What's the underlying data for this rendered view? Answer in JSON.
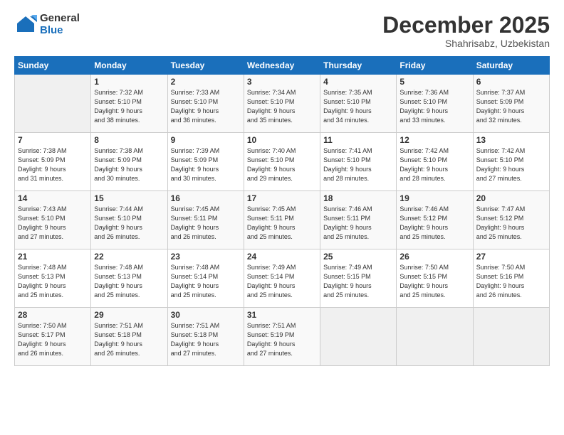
{
  "logo": {
    "general": "General",
    "blue": "Blue"
  },
  "title": {
    "month_year": "December 2025",
    "location": "Shahrisabz, Uzbekistan"
  },
  "header_days": [
    "Sunday",
    "Monday",
    "Tuesday",
    "Wednesday",
    "Thursday",
    "Friday",
    "Saturday"
  ],
  "weeks": [
    [
      {
        "day": "",
        "info": ""
      },
      {
        "day": "1",
        "info": "Sunrise: 7:32 AM\nSunset: 5:10 PM\nDaylight: 9 hours\nand 38 minutes."
      },
      {
        "day": "2",
        "info": "Sunrise: 7:33 AM\nSunset: 5:10 PM\nDaylight: 9 hours\nand 36 minutes."
      },
      {
        "day": "3",
        "info": "Sunrise: 7:34 AM\nSunset: 5:10 PM\nDaylight: 9 hours\nand 35 minutes."
      },
      {
        "day": "4",
        "info": "Sunrise: 7:35 AM\nSunset: 5:10 PM\nDaylight: 9 hours\nand 34 minutes."
      },
      {
        "day": "5",
        "info": "Sunrise: 7:36 AM\nSunset: 5:10 PM\nDaylight: 9 hours\nand 33 minutes."
      },
      {
        "day": "6",
        "info": "Sunrise: 7:37 AM\nSunset: 5:09 PM\nDaylight: 9 hours\nand 32 minutes."
      }
    ],
    [
      {
        "day": "7",
        "info": "Sunrise: 7:38 AM\nSunset: 5:09 PM\nDaylight: 9 hours\nand 31 minutes."
      },
      {
        "day": "8",
        "info": "Sunrise: 7:38 AM\nSunset: 5:09 PM\nDaylight: 9 hours\nand 30 minutes."
      },
      {
        "day": "9",
        "info": "Sunrise: 7:39 AM\nSunset: 5:09 PM\nDaylight: 9 hours\nand 30 minutes."
      },
      {
        "day": "10",
        "info": "Sunrise: 7:40 AM\nSunset: 5:10 PM\nDaylight: 9 hours\nand 29 minutes."
      },
      {
        "day": "11",
        "info": "Sunrise: 7:41 AM\nSunset: 5:10 PM\nDaylight: 9 hours\nand 28 minutes."
      },
      {
        "day": "12",
        "info": "Sunrise: 7:42 AM\nSunset: 5:10 PM\nDaylight: 9 hours\nand 28 minutes."
      },
      {
        "day": "13",
        "info": "Sunrise: 7:42 AM\nSunset: 5:10 PM\nDaylight: 9 hours\nand 27 minutes."
      }
    ],
    [
      {
        "day": "14",
        "info": "Sunrise: 7:43 AM\nSunset: 5:10 PM\nDaylight: 9 hours\nand 27 minutes."
      },
      {
        "day": "15",
        "info": "Sunrise: 7:44 AM\nSunset: 5:10 PM\nDaylight: 9 hours\nand 26 minutes."
      },
      {
        "day": "16",
        "info": "Sunrise: 7:45 AM\nSunset: 5:11 PM\nDaylight: 9 hours\nand 26 minutes."
      },
      {
        "day": "17",
        "info": "Sunrise: 7:45 AM\nSunset: 5:11 PM\nDaylight: 9 hours\nand 25 minutes."
      },
      {
        "day": "18",
        "info": "Sunrise: 7:46 AM\nSunset: 5:11 PM\nDaylight: 9 hours\nand 25 minutes."
      },
      {
        "day": "19",
        "info": "Sunrise: 7:46 AM\nSunset: 5:12 PM\nDaylight: 9 hours\nand 25 minutes."
      },
      {
        "day": "20",
        "info": "Sunrise: 7:47 AM\nSunset: 5:12 PM\nDaylight: 9 hours\nand 25 minutes."
      }
    ],
    [
      {
        "day": "21",
        "info": "Sunrise: 7:48 AM\nSunset: 5:13 PM\nDaylight: 9 hours\nand 25 minutes."
      },
      {
        "day": "22",
        "info": "Sunrise: 7:48 AM\nSunset: 5:13 PM\nDaylight: 9 hours\nand 25 minutes."
      },
      {
        "day": "23",
        "info": "Sunrise: 7:48 AM\nSunset: 5:14 PM\nDaylight: 9 hours\nand 25 minutes."
      },
      {
        "day": "24",
        "info": "Sunrise: 7:49 AM\nSunset: 5:14 PM\nDaylight: 9 hours\nand 25 minutes."
      },
      {
        "day": "25",
        "info": "Sunrise: 7:49 AM\nSunset: 5:15 PM\nDaylight: 9 hours\nand 25 minutes."
      },
      {
        "day": "26",
        "info": "Sunrise: 7:50 AM\nSunset: 5:15 PM\nDaylight: 9 hours\nand 25 minutes."
      },
      {
        "day": "27",
        "info": "Sunrise: 7:50 AM\nSunset: 5:16 PM\nDaylight: 9 hours\nand 26 minutes."
      }
    ],
    [
      {
        "day": "28",
        "info": "Sunrise: 7:50 AM\nSunset: 5:17 PM\nDaylight: 9 hours\nand 26 minutes."
      },
      {
        "day": "29",
        "info": "Sunrise: 7:51 AM\nSunset: 5:18 PM\nDaylight: 9 hours\nand 26 minutes."
      },
      {
        "day": "30",
        "info": "Sunrise: 7:51 AM\nSunset: 5:18 PM\nDaylight: 9 hours\nand 27 minutes."
      },
      {
        "day": "31",
        "info": "Sunrise: 7:51 AM\nSunset: 5:19 PM\nDaylight: 9 hours\nand 27 minutes."
      },
      {
        "day": "",
        "info": ""
      },
      {
        "day": "",
        "info": ""
      },
      {
        "day": "",
        "info": ""
      }
    ]
  ]
}
